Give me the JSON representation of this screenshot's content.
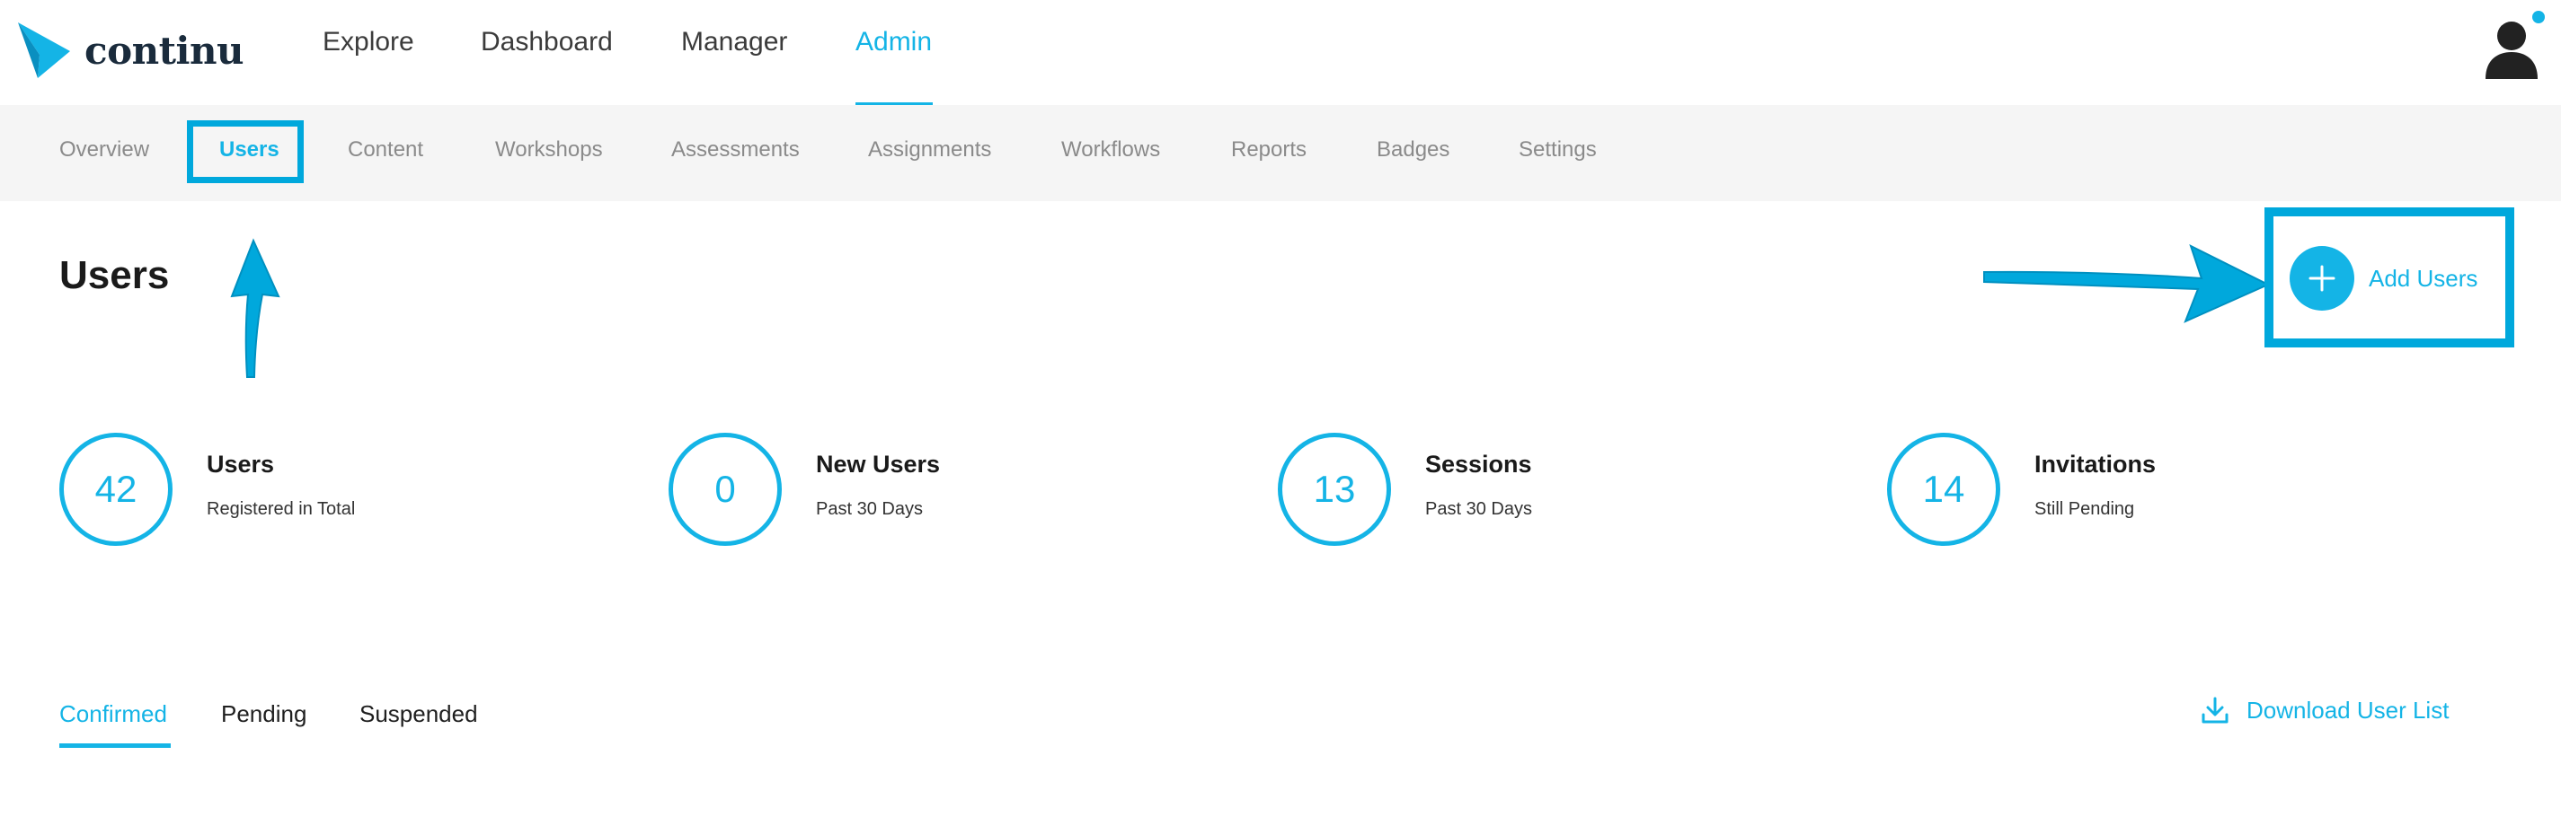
{
  "brand": {
    "name": "continu"
  },
  "main_nav": [
    "Explore",
    "Dashboard",
    "Manager",
    "Admin"
  ],
  "main_nav_active": "Admin",
  "sub_nav": [
    "Overview",
    "Users",
    "Content",
    "Workshops",
    "Assessments",
    "Assignments",
    "Workflows",
    "Reports",
    "Badges",
    "Settings"
  ],
  "sub_nav_active": "Users",
  "page": {
    "title": "Users"
  },
  "add_users": {
    "label": "Add Users",
    "icon": "plus-icon"
  },
  "stats": [
    {
      "value": "42",
      "title": "Users",
      "subtitle": "Registered in Total"
    },
    {
      "value": "0",
      "title": "New Users",
      "subtitle": "Past 30 Days"
    },
    {
      "value": "13",
      "title": "Sessions",
      "subtitle": "Past 30 Days"
    },
    {
      "value": "14",
      "title": "Invitations",
      "subtitle": "Still Pending"
    }
  ],
  "status_tabs": [
    "Confirmed",
    "Pending",
    "Suspended"
  ],
  "status_tab_active": "Confirmed",
  "download": {
    "label": "Download User List",
    "icon": "download-icon"
  },
  "colors": {
    "accent": "#14b4e6",
    "annotation": "#00a8dc",
    "brand_dark": "#1a2b3c",
    "subnav_bg": "#f5f5f5"
  }
}
